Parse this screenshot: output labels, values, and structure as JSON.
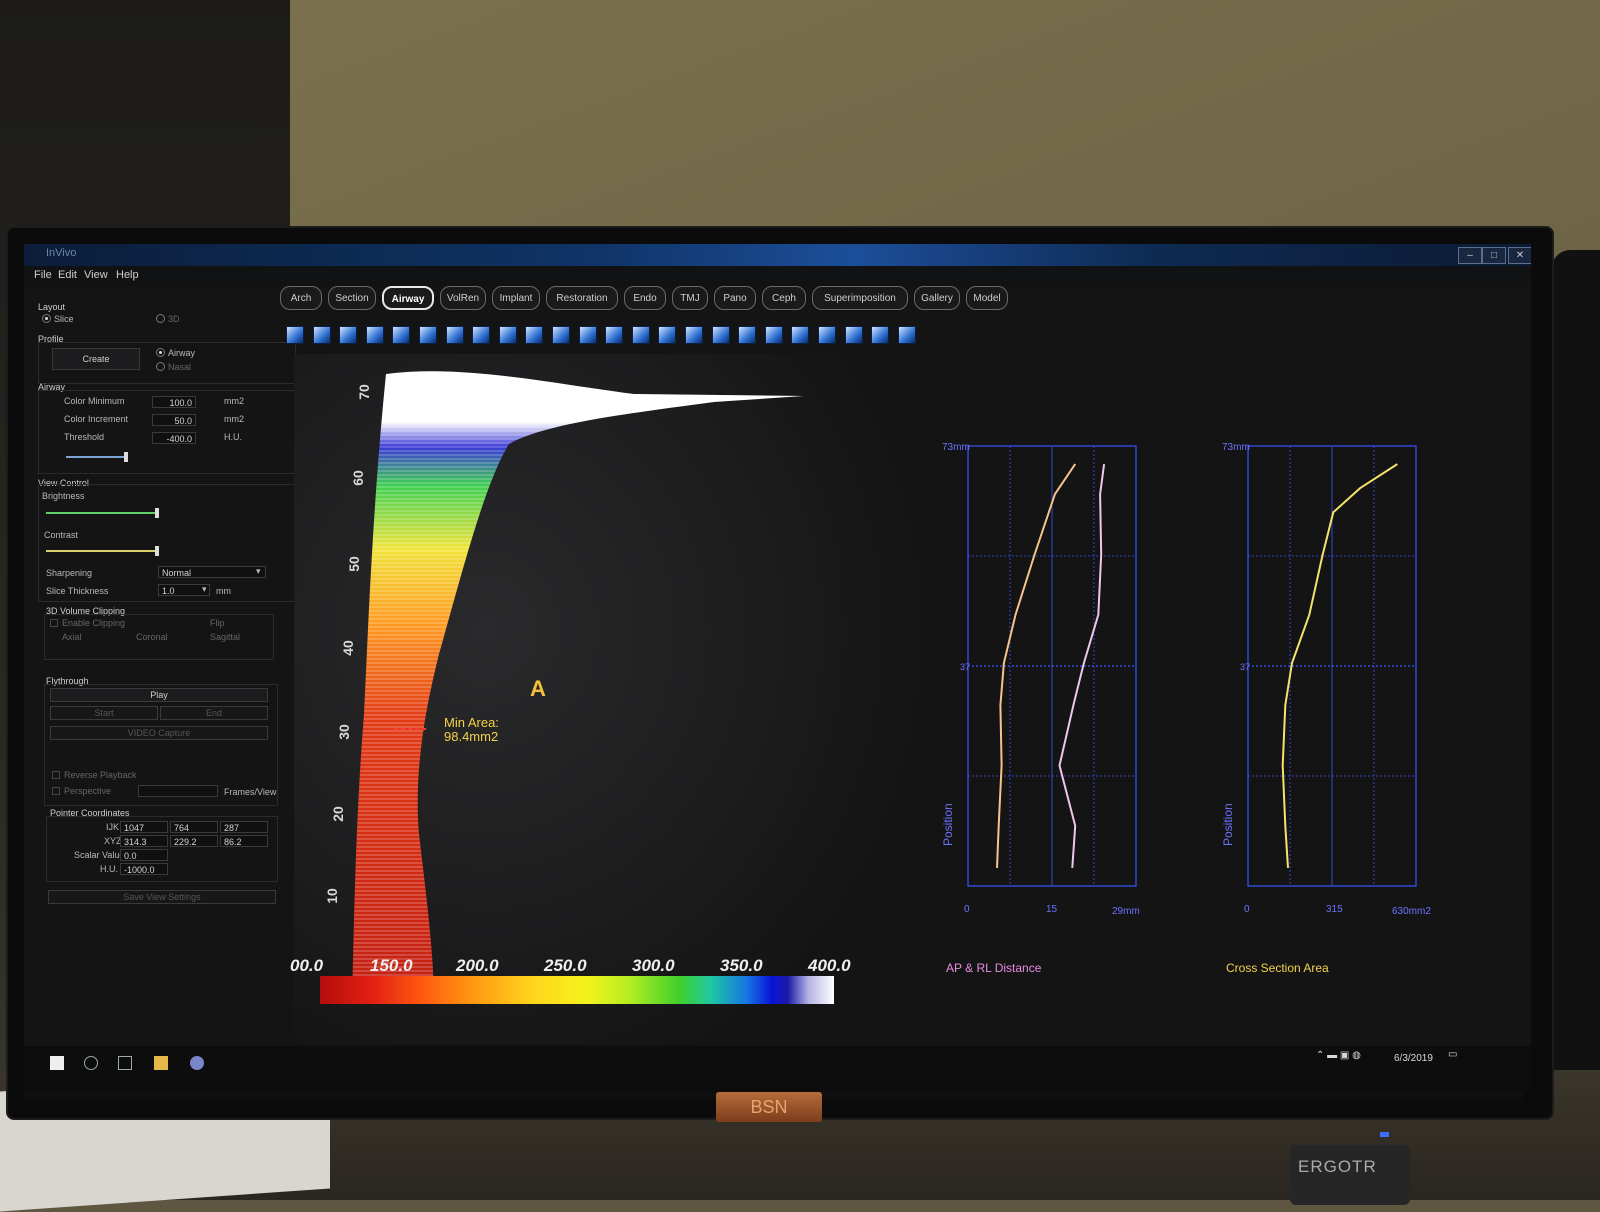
{
  "menu": [
    "File",
    "Edit",
    "View",
    "Help"
  ],
  "window": {
    "minimize": "–",
    "maximize": "□",
    "close": "✕"
  },
  "panel": {
    "layout": {
      "label": "Layout",
      "opt_slice": "Slice",
      "opt_3d": "3D"
    },
    "profile": {
      "label": "Profile",
      "create": "Create",
      "opt_airway": "Airway",
      "opt_nasal": "Nasal"
    },
    "airway": {
      "label": "Airway",
      "color_min_label": "Color Minimum",
      "color_min": "100.0",
      "color_min_unit": "mm2",
      "color_inc_label": "Color Increment",
      "color_inc": "50.0",
      "color_inc_unit": "mm2",
      "threshold_label": "Threshold",
      "threshold": "-400.0",
      "threshold_unit": "H.U."
    },
    "view_control": {
      "label": "View Control",
      "brightness": "Brightness",
      "contrast": "Contrast",
      "sharpening": "Sharpening",
      "sharpening_value": "Normal",
      "slice_thickness": "Slice Thickness",
      "slice_value": "1.0",
      "slice_unit": "mm"
    },
    "clipping": {
      "label": "3D Volume Clipping",
      "enable": "Enable Clipping",
      "flip": "Flip",
      "axial": "Axial",
      "coronal": "Coronal",
      "sagittal": "Sagittal"
    },
    "flythrough": {
      "label": "Flythrough",
      "play": "Play",
      "start": "Start",
      "end": "End",
      "video": "VIDEO Capture",
      "reverse": "Reverse Playback",
      "perspective": "Perspective",
      "frames": "Frames/View"
    },
    "pointer": {
      "label": "Pointer Coordinates",
      "ijk_label": "IJK",
      "ijk": [
        "1047",
        "764",
        "287"
      ],
      "xyz_label": "XYZ",
      "xyz": [
        "314.3",
        "229.2",
        "86.2"
      ],
      "scalar_label": "Scalar Value",
      "scalar": "0.0",
      "hu_label": "H.U.",
      "hu": "-1000.0"
    },
    "save": "Save View Settings"
  },
  "tabs": [
    "Arch",
    "Section",
    "Airway",
    "VolRen",
    "Implant",
    "Restoration",
    "Endo",
    "TMJ",
    "Pano",
    "Ceph",
    "Superimposition",
    "Gallery",
    "Model"
  ],
  "active_tab": "Airway",
  "viewer": {
    "height_labels": [
      "70",
      "60",
      "50",
      "40",
      "30",
      "20",
      "10"
    ],
    "marker": "A",
    "min_area_title": "Min Area:",
    "min_area_value": "98.4mm2",
    "colorbar_labels": [
      "00.0",
      "150.0",
      "200.0",
      "250.0",
      "300.0",
      "350.0",
      "400.0"
    ]
  },
  "charts": {
    "ap_rl": {
      "title": "AP & RL Distance",
      "y_top": "73mm",
      "y_mid": "37",
      "ylabel": "Position",
      "x0": "0",
      "x1": "15",
      "x2": "29mm"
    },
    "csa": {
      "title": "Cross Section Area",
      "y_top": "73mm",
      "y_mid": "37",
      "ylabel": "Position",
      "x0": "0",
      "x1": "315",
      "x2": "630mm2"
    }
  },
  "chart_data": [
    {
      "type": "line",
      "title": "AP & RL Distance",
      "xlabel": "",
      "ylabel": "Position",
      "xlim": [
        0,
        29
      ],
      "ylim": [
        0,
        73
      ],
      "series": [
        {
          "y": [
            3,
            10,
            20,
            30,
            37,
            45,
            55,
            65,
            70
          ],
          "x": [
            5.0,
            5.3,
            5.8,
            5.6,
            6.2,
            8.2,
            11.5,
            15.0,
            18.5
          ],
          "color": "#f5c48b"
        },
        {
          "y": [
            3,
            10,
            20,
            30,
            37,
            45,
            55,
            65,
            70
          ],
          "x": [
            18.0,
            18.5,
            15.8,
            18.2,
            20.0,
            22.5,
            23.0,
            22.8,
            23.5
          ],
          "color": "#f1c6e8"
        }
      ]
    },
    {
      "type": "line",
      "title": "Cross Section Area",
      "xlabel": "",
      "ylabel": "Position",
      "xlim": [
        0,
        630
      ],
      "ylim": [
        0,
        73
      ],
      "series": [
        {
          "y": [
            3,
            10,
            20,
            30,
            37,
            45,
            55,
            62,
            66,
            70
          ],
          "x": [
            150,
            140,
            130,
            140,
            165,
            230,
            280,
            320,
            420,
            560
          ],
          "color": "#f4e36a"
        }
      ]
    }
  ]
}
